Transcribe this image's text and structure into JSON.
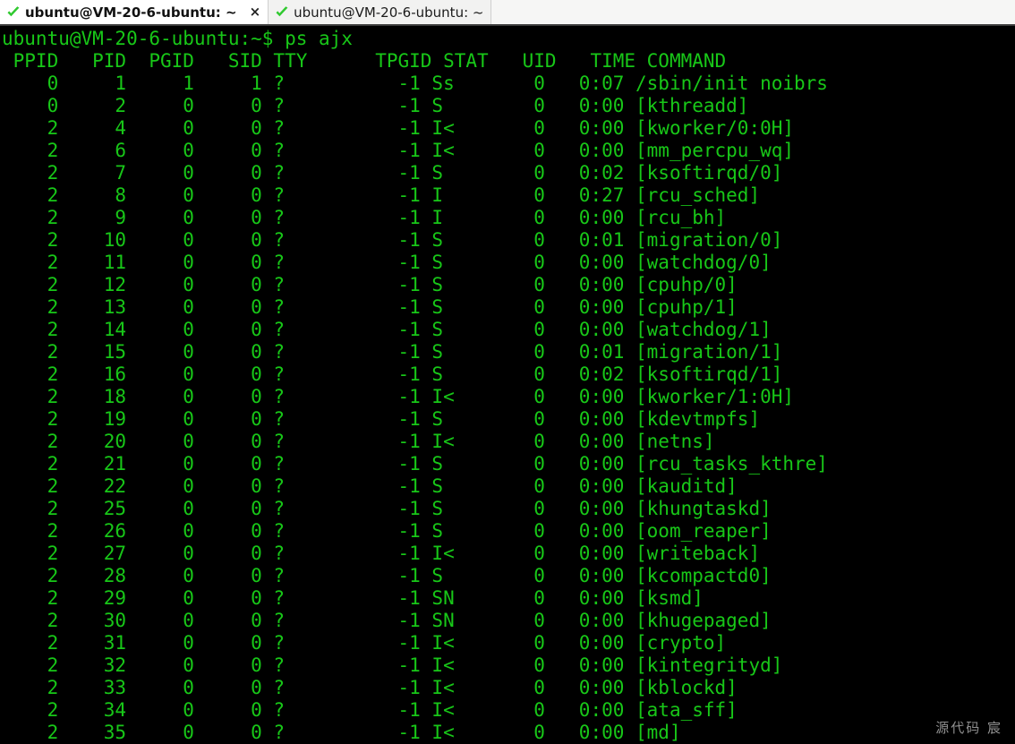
{
  "window": {
    "tabs": [
      {
        "title": "ubuntu@VM-20-6-ubuntu: ~",
        "icon": "check-icon",
        "active": true,
        "close_label": "×"
      },
      {
        "title": "ubuntu@VM-20-6-ubuntu: ~",
        "icon": "check-icon",
        "active": false,
        "close_label": ""
      }
    ]
  },
  "colors": {
    "terminal_bg": "#000000",
    "terminal_fg": "#18c718",
    "tab_check": "#2fc92f",
    "tabbar_bg": "#f6f6f5",
    "watermark": "#909090"
  },
  "terminal": {
    "prompt": "ubuntu@VM-20-6-ubuntu:~$",
    "command": "ps ajx",
    "prompt_line": "ubuntu@VM-20-6-ubuntu:~$ ps ajx",
    "columns": [
      "PPID",
      "PID",
      "PGID",
      "SID",
      "TTY",
      "TPGID",
      "STAT",
      "UID",
      "TIME",
      "COMMAND"
    ],
    "header_line": " PPID   PID  PGID   SID TTY      TPGID STAT   UID   TIME COMMAND",
    "rows": [
      {
        "ppid": "0",
        "pid": "1",
        "pgid": "1",
        "sid": "1",
        "tty": "?",
        "tpgid": "-1",
        "stat": "Ss",
        "uid": "0",
        "time": "0:07",
        "command": "/sbin/init noibrs"
      },
      {
        "ppid": "0",
        "pid": "2",
        "pgid": "0",
        "sid": "0",
        "tty": "?",
        "tpgid": "-1",
        "stat": "S",
        "uid": "0",
        "time": "0:00",
        "command": "[kthreadd]"
      },
      {
        "ppid": "2",
        "pid": "4",
        "pgid": "0",
        "sid": "0",
        "tty": "?",
        "tpgid": "-1",
        "stat": "I<",
        "uid": "0",
        "time": "0:00",
        "command": "[kworker/0:0H]"
      },
      {
        "ppid": "2",
        "pid": "6",
        "pgid": "0",
        "sid": "0",
        "tty": "?",
        "tpgid": "-1",
        "stat": "I<",
        "uid": "0",
        "time": "0:00",
        "command": "[mm_percpu_wq]"
      },
      {
        "ppid": "2",
        "pid": "7",
        "pgid": "0",
        "sid": "0",
        "tty": "?",
        "tpgid": "-1",
        "stat": "S",
        "uid": "0",
        "time": "0:02",
        "command": "[ksoftirqd/0]"
      },
      {
        "ppid": "2",
        "pid": "8",
        "pgid": "0",
        "sid": "0",
        "tty": "?",
        "tpgid": "-1",
        "stat": "I",
        "uid": "0",
        "time": "0:27",
        "command": "[rcu_sched]"
      },
      {
        "ppid": "2",
        "pid": "9",
        "pgid": "0",
        "sid": "0",
        "tty": "?",
        "tpgid": "-1",
        "stat": "I",
        "uid": "0",
        "time": "0:00",
        "command": "[rcu_bh]"
      },
      {
        "ppid": "2",
        "pid": "10",
        "pgid": "0",
        "sid": "0",
        "tty": "?",
        "tpgid": "-1",
        "stat": "S",
        "uid": "0",
        "time": "0:01",
        "command": "[migration/0]"
      },
      {
        "ppid": "2",
        "pid": "11",
        "pgid": "0",
        "sid": "0",
        "tty": "?",
        "tpgid": "-1",
        "stat": "S",
        "uid": "0",
        "time": "0:00",
        "command": "[watchdog/0]"
      },
      {
        "ppid": "2",
        "pid": "12",
        "pgid": "0",
        "sid": "0",
        "tty": "?",
        "tpgid": "-1",
        "stat": "S",
        "uid": "0",
        "time": "0:00",
        "command": "[cpuhp/0]"
      },
      {
        "ppid": "2",
        "pid": "13",
        "pgid": "0",
        "sid": "0",
        "tty": "?",
        "tpgid": "-1",
        "stat": "S",
        "uid": "0",
        "time": "0:00",
        "command": "[cpuhp/1]"
      },
      {
        "ppid": "2",
        "pid": "14",
        "pgid": "0",
        "sid": "0",
        "tty": "?",
        "tpgid": "-1",
        "stat": "S",
        "uid": "0",
        "time": "0:00",
        "command": "[watchdog/1]"
      },
      {
        "ppid": "2",
        "pid": "15",
        "pgid": "0",
        "sid": "0",
        "tty": "?",
        "tpgid": "-1",
        "stat": "S",
        "uid": "0",
        "time": "0:01",
        "command": "[migration/1]"
      },
      {
        "ppid": "2",
        "pid": "16",
        "pgid": "0",
        "sid": "0",
        "tty": "?",
        "tpgid": "-1",
        "stat": "S",
        "uid": "0",
        "time": "0:02",
        "command": "[ksoftirqd/1]"
      },
      {
        "ppid": "2",
        "pid": "18",
        "pgid": "0",
        "sid": "0",
        "tty": "?",
        "tpgid": "-1",
        "stat": "I<",
        "uid": "0",
        "time": "0:00",
        "command": "[kworker/1:0H]"
      },
      {
        "ppid": "2",
        "pid": "19",
        "pgid": "0",
        "sid": "0",
        "tty": "?",
        "tpgid": "-1",
        "stat": "S",
        "uid": "0",
        "time": "0:00",
        "command": "[kdevtmpfs]"
      },
      {
        "ppid": "2",
        "pid": "20",
        "pgid": "0",
        "sid": "0",
        "tty": "?",
        "tpgid": "-1",
        "stat": "I<",
        "uid": "0",
        "time": "0:00",
        "command": "[netns]"
      },
      {
        "ppid": "2",
        "pid": "21",
        "pgid": "0",
        "sid": "0",
        "tty": "?",
        "tpgid": "-1",
        "stat": "S",
        "uid": "0",
        "time": "0:00",
        "command": "[rcu_tasks_kthre]"
      },
      {
        "ppid": "2",
        "pid": "22",
        "pgid": "0",
        "sid": "0",
        "tty": "?",
        "tpgid": "-1",
        "stat": "S",
        "uid": "0",
        "time": "0:00",
        "command": "[kauditd]"
      },
      {
        "ppid": "2",
        "pid": "25",
        "pgid": "0",
        "sid": "0",
        "tty": "?",
        "tpgid": "-1",
        "stat": "S",
        "uid": "0",
        "time": "0:00",
        "command": "[khungtaskd]"
      },
      {
        "ppid": "2",
        "pid": "26",
        "pgid": "0",
        "sid": "0",
        "tty": "?",
        "tpgid": "-1",
        "stat": "S",
        "uid": "0",
        "time": "0:00",
        "command": "[oom_reaper]"
      },
      {
        "ppid": "2",
        "pid": "27",
        "pgid": "0",
        "sid": "0",
        "tty": "?",
        "tpgid": "-1",
        "stat": "I<",
        "uid": "0",
        "time": "0:00",
        "command": "[writeback]"
      },
      {
        "ppid": "2",
        "pid": "28",
        "pgid": "0",
        "sid": "0",
        "tty": "?",
        "tpgid": "-1",
        "stat": "S",
        "uid": "0",
        "time": "0:00",
        "command": "[kcompactd0]"
      },
      {
        "ppid": "2",
        "pid": "29",
        "pgid": "0",
        "sid": "0",
        "tty": "?",
        "tpgid": "-1",
        "stat": "SN",
        "uid": "0",
        "time": "0:00",
        "command": "[ksmd]"
      },
      {
        "ppid": "2",
        "pid": "30",
        "pgid": "0",
        "sid": "0",
        "tty": "?",
        "tpgid": "-1",
        "stat": "SN",
        "uid": "0",
        "time": "0:00",
        "command": "[khugepaged]"
      },
      {
        "ppid": "2",
        "pid": "31",
        "pgid": "0",
        "sid": "0",
        "tty": "?",
        "tpgid": "-1",
        "stat": "I<",
        "uid": "0",
        "time": "0:00",
        "command": "[crypto]"
      },
      {
        "ppid": "2",
        "pid": "32",
        "pgid": "0",
        "sid": "0",
        "tty": "?",
        "tpgid": "-1",
        "stat": "I<",
        "uid": "0",
        "time": "0:00",
        "command": "[kintegrityd]"
      },
      {
        "ppid": "2",
        "pid": "33",
        "pgid": "0",
        "sid": "0",
        "tty": "?",
        "tpgid": "-1",
        "stat": "I<",
        "uid": "0",
        "time": "0:00",
        "command": "[kblockd]"
      },
      {
        "ppid": "2",
        "pid": "34",
        "pgid": "0",
        "sid": "0",
        "tty": "?",
        "tpgid": "-1",
        "stat": "I<",
        "uid": "0",
        "time": "0:00",
        "command": "[ata_sff]"
      },
      {
        "ppid": "2",
        "pid": "35",
        "pgid": "0",
        "sid": "0",
        "tty": "?",
        "tpgid": "-1",
        "stat": "I<",
        "uid": "0",
        "time": "0:00",
        "command": "[md]"
      }
    ]
  },
  "watermark": {
    "text": "源代码  宸"
  }
}
